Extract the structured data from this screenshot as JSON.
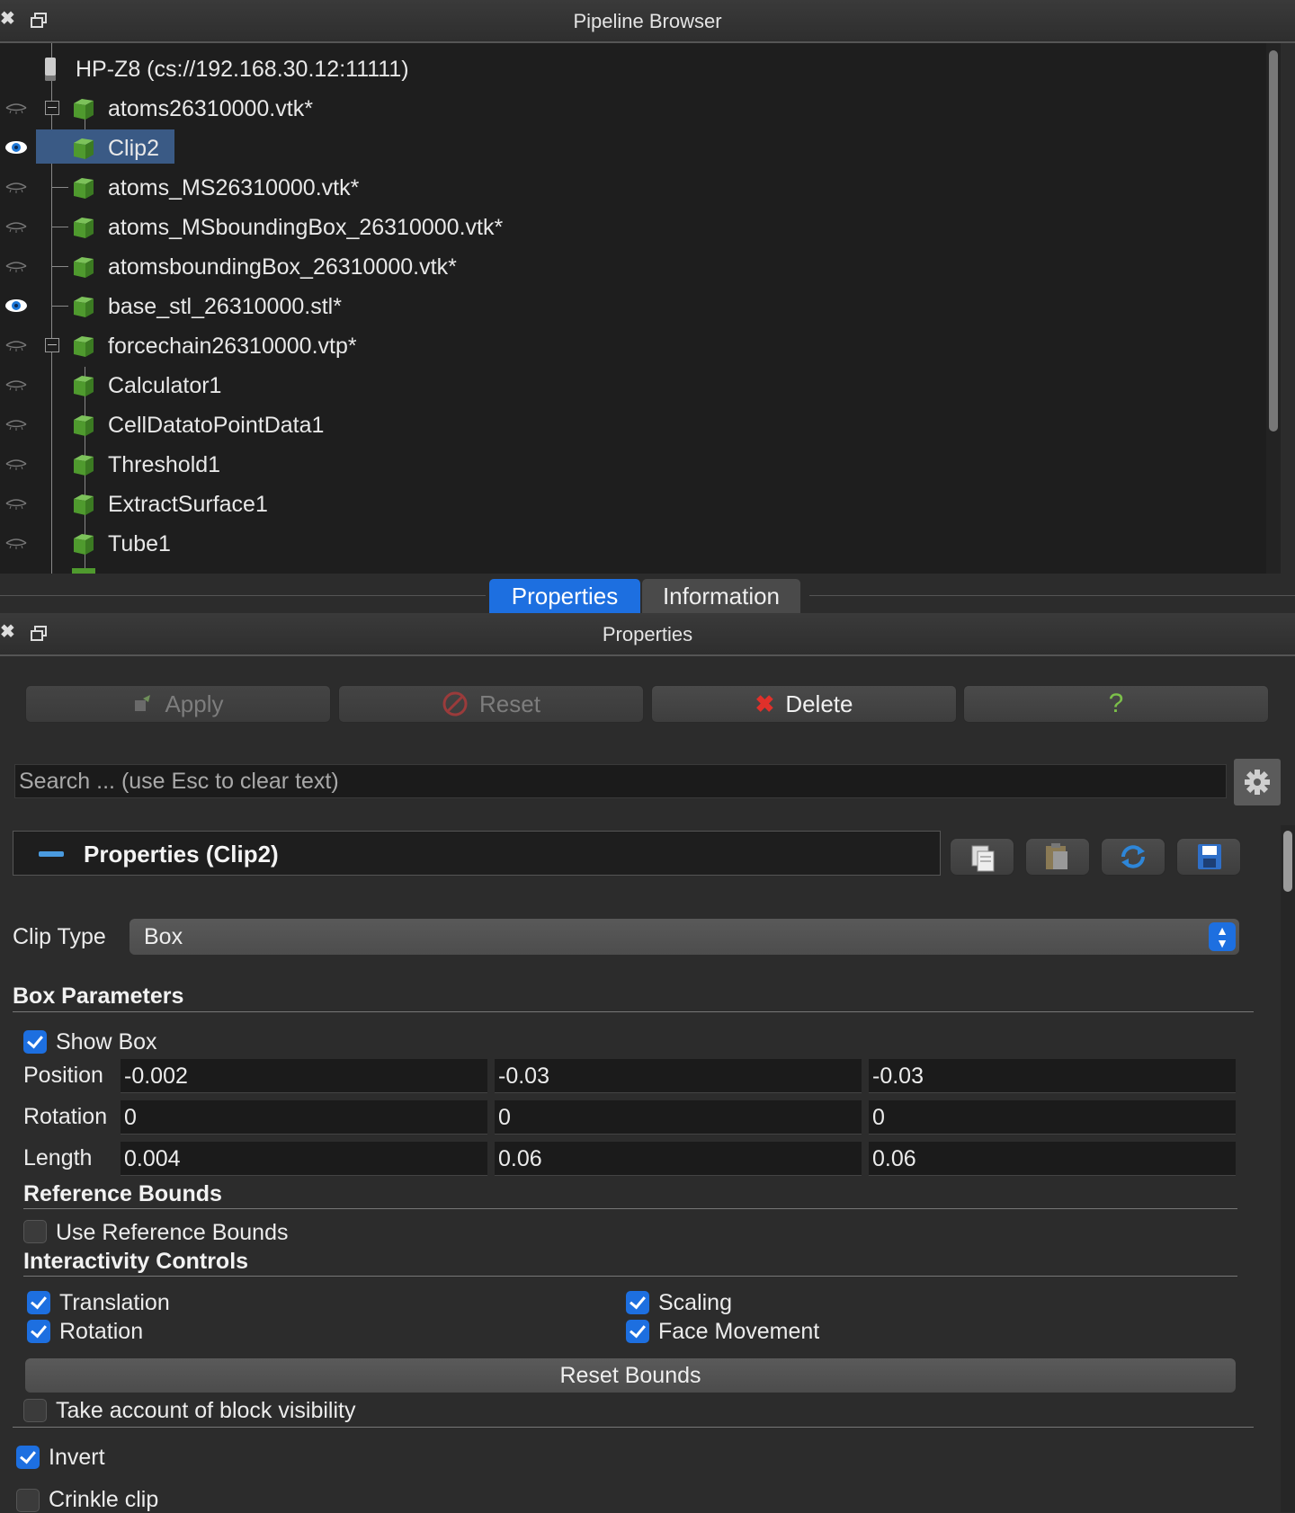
{
  "pipeline_browser": {
    "title": "Pipeline Browser",
    "server": "HP-Z8 (cs://192.168.30.12:11111)",
    "items": [
      {
        "label": "atoms26310000.vtk*",
        "visible": false,
        "expandable": true,
        "selected": false
      },
      {
        "label": "Clip2",
        "visible": true,
        "expandable": false,
        "selected": true
      },
      {
        "label": "atoms_MS26310000.vtk*",
        "visible": false,
        "expandable": false,
        "selected": false
      },
      {
        "label": "atoms_MSboundingBox_26310000.vtk*",
        "visible": false,
        "expandable": false,
        "selected": false
      },
      {
        "label": "atomsboundingBox_26310000.vtk*",
        "visible": false,
        "expandable": false,
        "selected": false
      },
      {
        "label": "base_stl_26310000.stl*",
        "visible": true,
        "expandable": false,
        "selected": false
      },
      {
        "label": "forcechain26310000.vtp*",
        "visible": false,
        "expandable": true,
        "selected": false
      },
      {
        "label": "Calculator1",
        "visible": false,
        "expandable": false,
        "selected": false
      },
      {
        "label": "CellDatatoPointData1",
        "visible": false,
        "expandable": false,
        "selected": false
      },
      {
        "label": "Threshold1",
        "visible": false,
        "expandable": false,
        "selected": false
      },
      {
        "label": "ExtractSurface1",
        "visible": false,
        "expandable": false,
        "selected": false
      },
      {
        "label": "Tube1",
        "visible": false,
        "expandable": false,
        "selected": false
      }
    ]
  },
  "tabs": [
    {
      "label": "Properties",
      "active": true
    },
    {
      "label": "Information",
      "active": false
    }
  ],
  "properties_panel": {
    "title": "Properties",
    "buttons": {
      "apply": "Apply",
      "reset": "Reset",
      "delete": "Delete",
      "help": "?"
    },
    "search_placeholder": "Search ... (use Esc to clear text)",
    "section_title": "Properties (Clip2)",
    "clip_type_label": "Clip Type",
    "clip_type_value": "Box",
    "box_parameters": {
      "header": "Box Parameters",
      "show_box_label": "Show Box",
      "show_box": true,
      "position_label": "Position",
      "position": [
        "-0.002",
        "-0.03",
        "-0.03"
      ],
      "rotation_label": "Rotation",
      "rotation": [
        "0",
        "0",
        "0"
      ],
      "length_label": "Length",
      "length": [
        "0.004",
        "0.06",
        "0.06"
      ]
    },
    "reference_bounds": {
      "header": "Reference Bounds",
      "use_label": "Use Reference Bounds",
      "use": false
    },
    "interactivity": {
      "header": "Interactivity Controls",
      "translation_label": "Translation",
      "translation": true,
      "scaling_label": "Scaling",
      "scaling": true,
      "rotation_label": "Rotation",
      "rotation": true,
      "face_movement_label": "Face Movement",
      "face_movement": true,
      "reset_bounds": "Reset Bounds"
    },
    "block_visibility_label": "Take account of block visibility",
    "block_visibility": false,
    "invert_label": "Invert",
    "invert": true,
    "crinkle_label": "Crinkle clip",
    "crinkle": false
  },
  "colors": {
    "accent": "#1d6fe0",
    "selection": "#3a5a85",
    "delete_icon": "#e0302a",
    "help_icon": "#7cc04a",
    "cube_green": "#4f9a2e"
  }
}
